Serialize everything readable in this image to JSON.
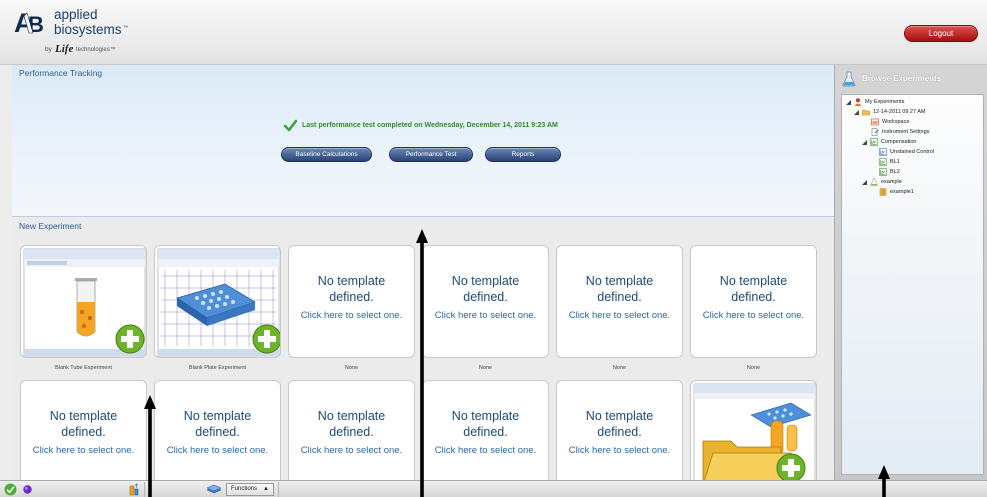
{
  "header": {
    "brand": {
      "line1": "applied",
      "line2": "biosystems",
      "tm": "™",
      "byline_prefix": "by",
      "byline_brand": "Life",
      "byline_suffix": "technologies™"
    },
    "logout_label": "Logout"
  },
  "performance": {
    "section_title": "Performance Tracking",
    "status_text": "Last performance test completed on Wednesday, December 14, 2011 9:23 AM",
    "buttons": [
      "Baseline Calculations",
      "Performance Test",
      "Reports"
    ]
  },
  "new_experiment": {
    "section_title": "New Experiment",
    "tiles": [
      {
        "label": "Blank Tube Experiment",
        "type": "thumbnail",
        "thumb": "tube-thumbnail"
      },
      {
        "label": "Blank Plate Experiment",
        "type": "thumbnail",
        "thumb": "plate-thumbnail"
      },
      {
        "label": "None",
        "type": "empty",
        "line1": "No template",
        "line2": "defined.",
        "line3": "Click here to select one."
      },
      {
        "label": "None",
        "type": "empty",
        "line1": "No template",
        "line2": "defined.",
        "line3": "Click here to select one."
      },
      {
        "label": "None",
        "type": "empty",
        "line1": "No template",
        "line2": "defined.",
        "line3": "Click here to select one."
      },
      {
        "label": "None",
        "type": "empty",
        "line1": "No template",
        "line2": "defined.",
        "line3": "Click here to select one."
      },
      {
        "label": "",
        "type": "empty",
        "line1": "No template",
        "line2": "defined.",
        "line3": "Click here to select one."
      },
      {
        "label": "",
        "type": "empty",
        "line1": "No template",
        "line2": "defined.",
        "line3": "Click here to select one."
      },
      {
        "label": "",
        "type": "empty",
        "line1": "No template",
        "line2": "defined.",
        "line3": "Click here to select one."
      },
      {
        "label": "",
        "type": "empty",
        "line1": "No template",
        "line2": "defined.",
        "line3": "Click here to select one."
      },
      {
        "label": "",
        "type": "empty",
        "line1": "No template",
        "line2": "defined.",
        "line3": "Click here to select one."
      },
      {
        "label": "",
        "type": "thumbnail",
        "thumb": "folder-thumbnail"
      }
    ]
  },
  "browse": {
    "title": "Browse Experiments",
    "tree": [
      {
        "label": "My Experiments",
        "icon": "user-folder-icon",
        "expanded": true
      },
      {
        "label": "12-14-2011 09 27 AM",
        "icon": "folder-icon",
        "expanded": true
      },
      {
        "label": "Workspace",
        "icon": "workspace-icon"
      },
      {
        "label": "Instrument Settings",
        "icon": "settings-doc-icon"
      },
      {
        "label": "Compensation",
        "icon": "chart-icon",
        "expanded": true
      },
      {
        "label": "Unstained Control",
        "icon": "chart-icon"
      },
      {
        "label": "BL1",
        "icon": "chart-icon"
      },
      {
        "label": "BL2",
        "icon": "chart-icon"
      },
      {
        "label": "example",
        "icon": "flask-icon",
        "expanded": true
      },
      {
        "label": "example1",
        "icon": "plate-icon"
      }
    ]
  },
  "taskbar": {
    "functions_label": "Functions",
    "functions_arrow": "▲"
  },
  "colors": {
    "accent_blue": "#2d5d94",
    "logout_red": "#c0191b",
    "status_green": "#2f8a2f",
    "pill_blue": "#34508a"
  }
}
